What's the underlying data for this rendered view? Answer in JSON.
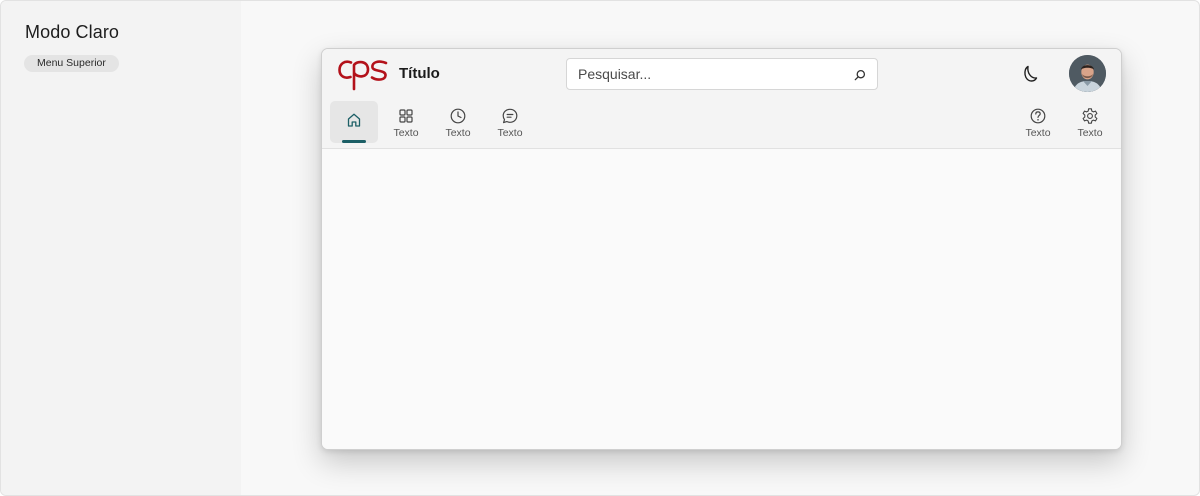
{
  "sidebar": {
    "title": "Modo Claro",
    "chip": "Menu Superior"
  },
  "app": {
    "logo_text": "CPS",
    "title": "Título",
    "brand_color": "#b3111a",
    "accent_color": "#1c5f66"
  },
  "search": {
    "placeholder": "Pesquisar...",
    "value": "",
    "icon": "search-icon"
  },
  "header_actions": {
    "theme_icon": "moon-icon",
    "avatar_icon": "user-avatar"
  },
  "nav": {
    "items": [
      {
        "icon": "home-icon",
        "label": "",
        "active": true
      },
      {
        "icon": "grid-icon",
        "label": "Texto"
      },
      {
        "icon": "clock-icon",
        "label": "Texto"
      },
      {
        "icon": "chat-icon",
        "label": "Texto"
      }
    ],
    "right_items": [
      {
        "icon": "help-icon",
        "label": "Texto"
      },
      {
        "icon": "gear-icon",
        "label": "Texto"
      }
    ]
  }
}
